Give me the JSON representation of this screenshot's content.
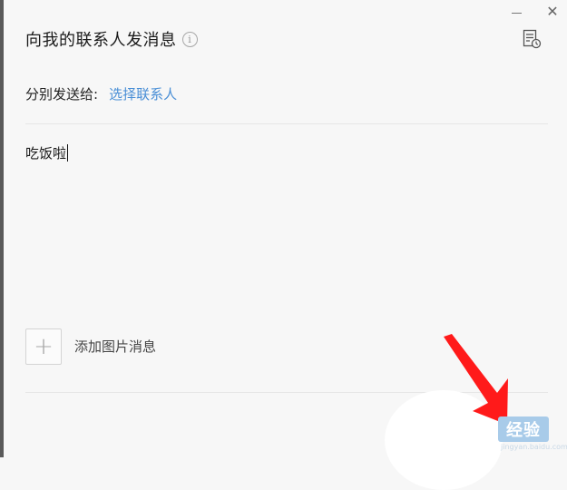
{
  "window": {
    "title": "向我的联系人发消息",
    "info_icon": "info-icon",
    "history_icon": "history-icon",
    "minimize_icon": "minimize-icon",
    "close_icon": "close-icon",
    "close_glyph": "✕"
  },
  "recipient": {
    "label": "分别发送给:",
    "select_link": "选择联系人"
  },
  "message": {
    "value": "吃饭啦"
  },
  "attachment": {
    "plus_glyph": "+",
    "label": "添加图片消息"
  },
  "watermark": {
    "text": "经验",
    "sub": "jingyan.baidu.com"
  },
  "colors": {
    "link": "#4a8fd6",
    "arrow": "#ff1a1a",
    "background": "#f7f7f7"
  }
}
